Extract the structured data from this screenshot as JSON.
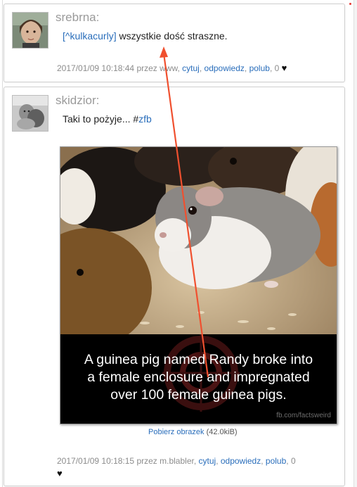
{
  "posts": [
    {
      "username": "srebrna:",
      "mention": "[^kulkacurly]",
      "text": " wszystkie dość straszne.",
      "timestamp": "2017/01/09 10:18:44",
      "via": "przez www,",
      "actions": {
        "quote": "cytuj",
        "reply": "odpowiedz",
        "like": "polub"
      },
      "likes": "0",
      "heart_icon": "heart-icon"
    },
    {
      "username": "skidzior:",
      "text": "Taki to pożyje... #",
      "hashtag": "zfb",
      "image": {
        "caption_lines": [
          "A guinea pig named Randy broke into",
          "a female enclosure and impregnated",
          "over 100 female guinea pigs."
        ],
        "watermark": "fb.com/factsweird"
      },
      "download": {
        "label": "Pobierz obrazek",
        "size": "(42.0kiB)"
      },
      "timestamp": "2017/01/09 10:18:15",
      "via": "przez m.blabler,",
      "actions": {
        "quote": "cytuj",
        "reply": "odpowiedz",
        "like": "polub"
      },
      "likes": "0",
      "heart_icon": "heart-icon"
    }
  ],
  "colors": {
    "link": "#2a6ebb",
    "arrow": "#f0502f",
    "meta": "#8c8c8c",
    "username": "#9a9a9a"
  }
}
